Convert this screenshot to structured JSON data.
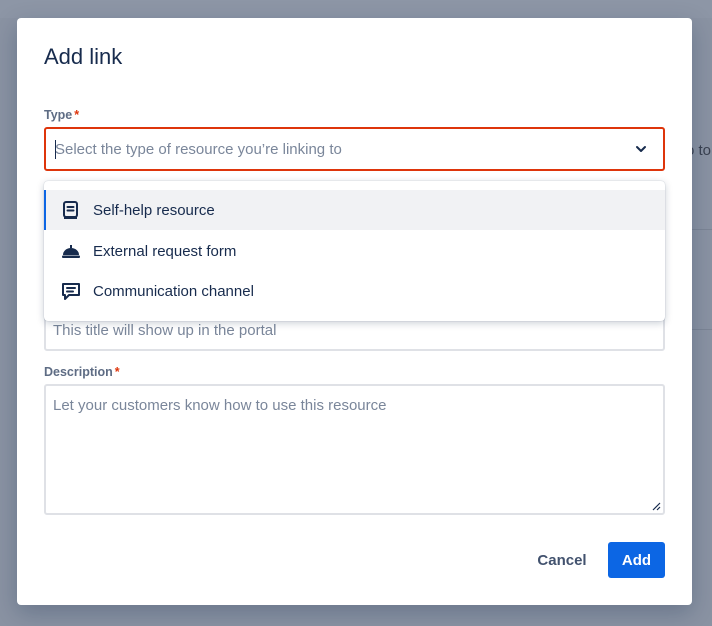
{
  "modal": {
    "title": "Add link",
    "type_label": "Type",
    "required_mark": "*",
    "type_placeholder": "Select the type of resource you’re linking to",
    "title_placeholder": "This title will show up in the portal",
    "description_label": "Description",
    "description_placeholder": "Let your customers know how to use this resource",
    "cancel_label": "Cancel",
    "add_label": "Add"
  },
  "dropdown": {
    "items": [
      {
        "label": "Self-help resource",
        "icon": "book-icon",
        "highlighted": true
      },
      {
        "label": "External request form",
        "icon": "service-bell-icon",
        "highlighted": false
      },
      {
        "label": "Communication channel",
        "icon": "chat-icon",
        "highlighted": false
      }
    ]
  },
  "background": {
    "peek_text": "o to"
  },
  "colors": {
    "accent": "#0c66e4",
    "error": "#de350b",
    "text": "#172b4d",
    "placeholder": "#7a869a"
  }
}
